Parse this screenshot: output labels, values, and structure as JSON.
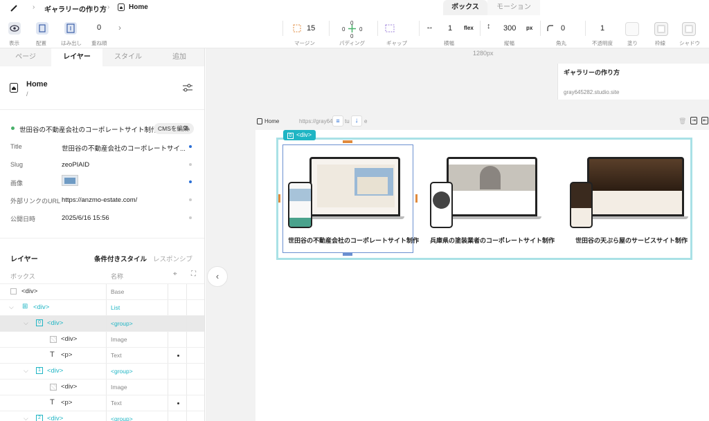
{
  "header": {
    "breadcrumb_1": "ギャラリーの作り方",
    "breadcrumb_2": "Home",
    "tab_box": "ボックス",
    "tab_motion": "モーション"
  },
  "toolbar": {
    "display": "表示",
    "position": "配置",
    "overflow": "はみ出し",
    "zindex": "重ね順",
    "zindex_value": "0",
    "margin": "マージン",
    "margin_value": "15",
    "padding": "パディング",
    "padding_top": "0",
    "padding_left": "0",
    "padding_right": "0",
    "padding_bottom": "0",
    "gap": "ギャップ",
    "width": "横幅",
    "width_value": "1",
    "width_unit": "flex",
    "height": "縦幅",
    "height_value": "300",
    "height_unit": "px",
    "radius": "角丸",
    "radius_value": "0",
    "opacity": "不透明度",
    "opacity_value": "1",
    "fill": "塗り",
    "border": "枠線",
    "shadow": "シャドウ"
  },
  "left_tabs": [
    "ページ",
    "レイヤー",
    "スタイル",
    "追加"
  ],
  "page_info": {
    "title": "Home",
    "path": "/"
  },
  "cms": {
    "item_title": "世田谷の不動産会社のコーポレートサイト制作",
    "edit_button": "CMSを編集",
    "fields": [
      {
        "label": "Title",
        "value": "世田谷の不動産会社のコーポレートサイ..."
      },
      {
        "label": "Slug",
        "value": "zeoPIAID"
      },
      {
        "label": "画像",
        "value": ""
      },
      {
        "label": "外部リンクのURL",
        "value": "https://anzmo-estate.com/"
      },
      {
        "label": "公開日時",
        "value": "2025/6/16 15:56"
      }
    ]
  },
  "layers": {
    "heading": "レイヤー",
    "tab_conditional": "条件付きスタイル",
    "tab_responsive": "レスポンシブ",
    "col_box": "ボックス",
    "col_name": "名称",
    "rows": [
      {
        "name": "<div>",
        "type": "Base"
      },
      {
        "name": "<div>",
        "type": "List"
      },
      {
        "name": "<div>",
        "type": "<group>",
        "index": "0"
      },
      {
        "name": "<div>",
        "type": "Image"
      },
      {
        "name": "<p>",
        "type": "Text"
      },
      {
        "name": "<div>",
        "type": "<group>",
        "index": "1"
      },
      {
        "name": "<div>",
        "type": "Image"
      },
      {
        "name": "<p>",
        "type": "Text"
      },
      {
        "name": "<div>",
        "type": "<group>",
        "index": "2"
      }
    ]
  },
  "canvas": {
    "ruler_label": "1280px",
    "preview_title": "ギャラリーの作り方",
    "preview_url": "gray645282.studio.site",
    "page_label": "Home",
    "page_url": "https://gray64",
    "page_url_tail": "tu",
    "page_url_end": "e",
    "selection_tag": "<div>",
    "selection_index": "0",
    "cards": [
      {
        "caption": "世田谷の不動産会社のコーポレートサイト制作"
      },
      {
        "caption": "兵庫県の塗装業者のコーポレートサイト制作"
      },
      {
        "caption": "世田谷の天ぷら屋のサービスサイト制作"
      }
    ]
  },
  "colors": {
    "accent": "#1fb5c4",
    "link_blue": "#2b6fd6",
    "selection": "#a9e1e6"
  }
}
